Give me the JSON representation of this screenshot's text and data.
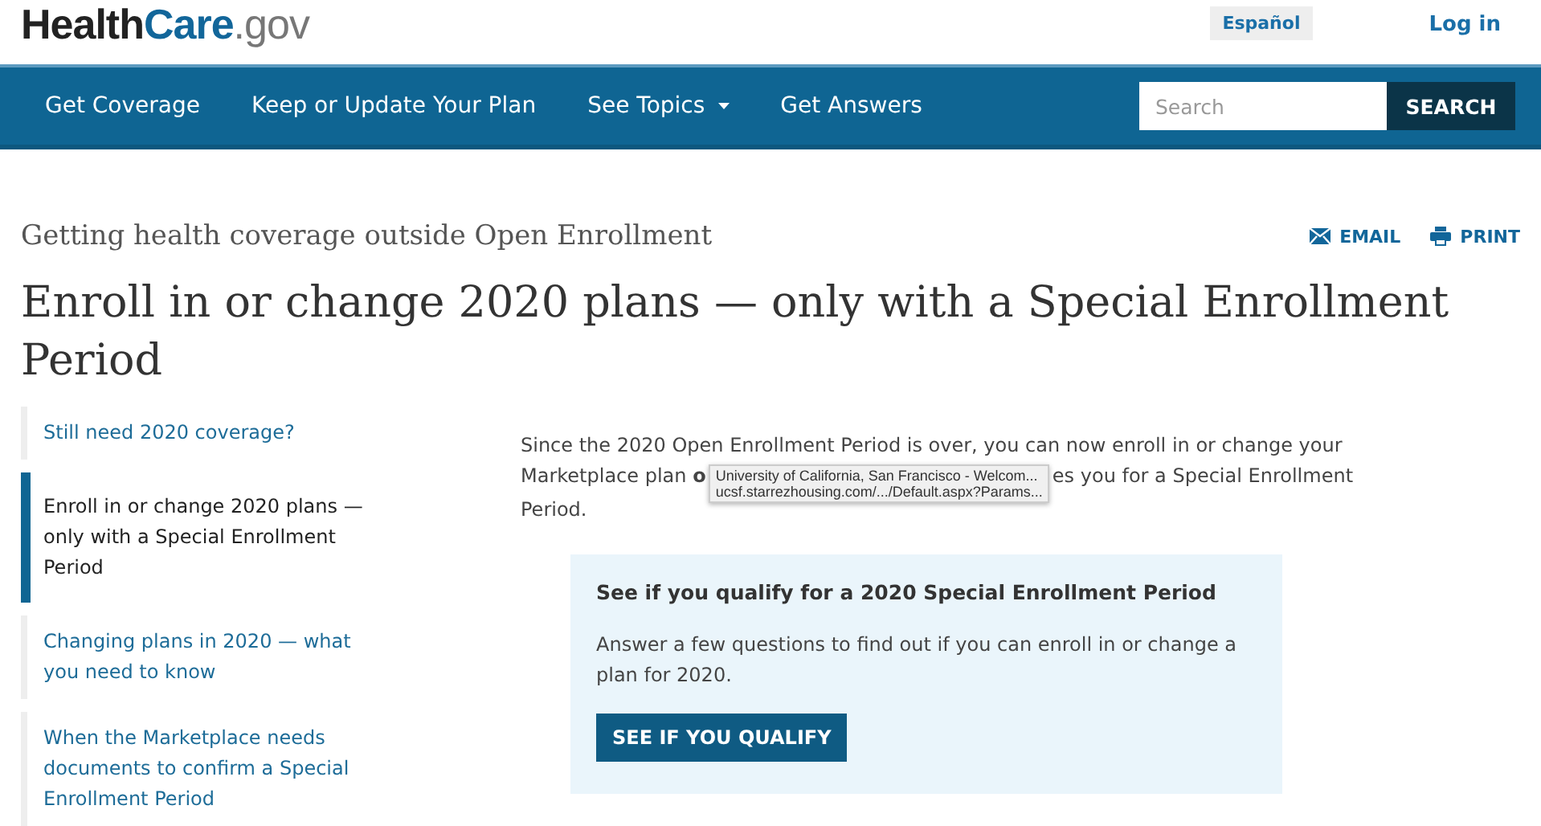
{
  "logo": {
    "parts": [
      {
        "text": "Health",
        "kind": "dark"
      },
      {
        "text": "Care",
        "kind": "accent"
      },
      {
        "text": ".gov",
        "kind": "muted"
      }
    ]
  },
  "top_links": {
    "language": "Español",
    "login": "Log in"
  },
  "nav": {
    "items": [
      {
        "label": "Get Coverage",
        "dropdown": false
      },
      {
        "label": "Keep or Update Your Plan",
        "dropdown": false
      },
      {
        "label": "See Topics",
        "dropdown": true
      },
      {
        "label": "Get Answers",
        "dropdown": false
      }
    ],
    "search": {
      "placeholder": "Search",
      "button": "SEARCH"
    }
  },
  "page": {
    "eyebrow": "Getting health coverage outside Open Enrollment",
    "title": "Enroll in or change 2020 plans — only with a Special Enrollment Period",
    "actions": [
      {
        "label": "EMAIL",
        "kind": "email"
      },
      {
        "label": "PRINT",
        "kind": "print"
      }
    ]
  },
  "sidebar": {
    "items": [
      {
        "label": "Still need 2020 coverage?",
        "selected": false
      },
      {
        "label": "Enroll in or change 2020 plans — only with a Special Enrollment Period",
        "selected": true
      },
      {
        "label": "Changing plans in 2020 — what you need to know",
        "selected": false
      },
      {
        "label": "When the Marketplace needs documents to confirm a Special Enrollment Period",
        "selected": false
      }
    ]
  },
  "intro": {
    "line_1": "Since the 2020 Open Enrollment Period is over, you can now enroll in or change your",
    "line_2_start": "Marketplace plan **o**",
    "line_2_end": "es you for a Special Enrollment",
    "line_3": "Period."
  },
  "link_tooltip": {
    "title": "University of California, San Francisco - Welcom...",
    "url": "ucsf.starrezhousing.com/.../Default.aspx?Params..."
  },
  "callout": {
    "heading": "See if you qualify for a 2020 Special Enrollment Period",
    "text": "Answer a few questions to find out if you can enroll in or change a plan for 2020.",
    "button": "SEE IF YOU QUALIFY"
  }
}
